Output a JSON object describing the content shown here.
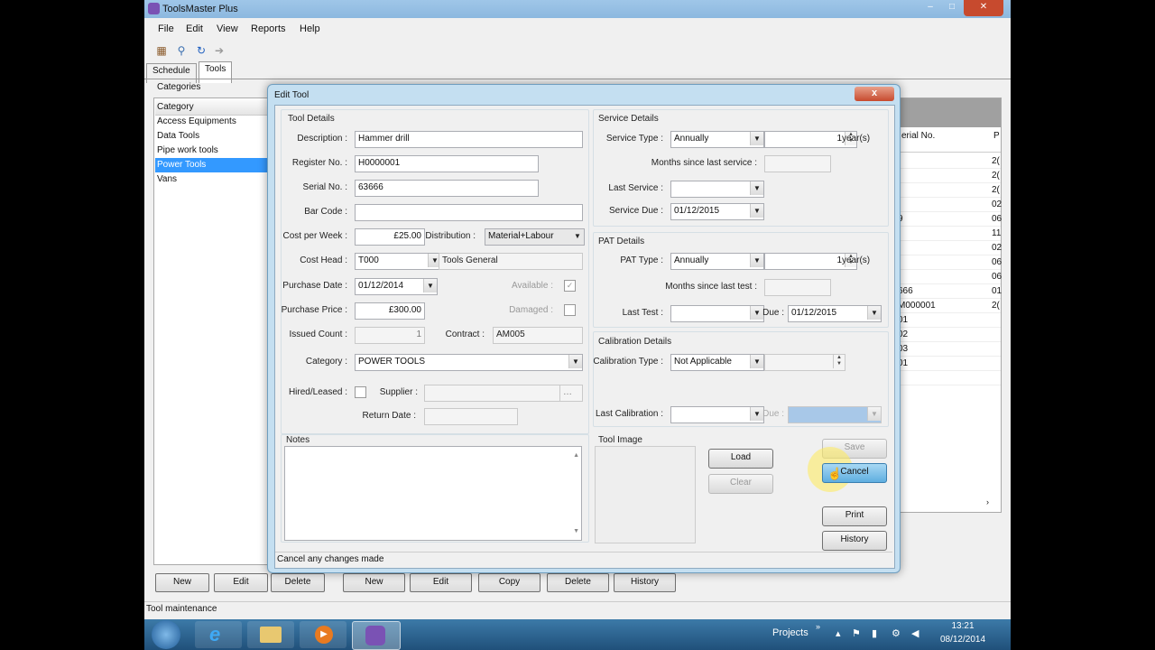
{
  "app": {
    "title": "ToolsMaster Plus"
  },
  "menu": [
    "File",
    "Edit",
    "View",
    "Reports",
    "Help"
  ],
  "tabs": [
    {
      "label": "Schedule"
    },
    {
      "label": "Tools"
    }
  ],
  "categories": {
    "heading": "Categories",
    "column": "Category",
    "items": [
      "Access Equipments",
      "Data Tools",
      "Pipe work tools",
      "Power Tools",
      "Vans"
    ],
    "selected": "Power Tools"
  },
  "tools_grid": {
    "col_serial": "erial No.",
    "col_p": "P",
    "serial_fragments": [
      "",
      "",
      "",
      "",
      "9",
      "",
      "",
      "",
      "",
      "666",
      "M000001",
      "01",
      "02",
      "03",
      "01",
      ""
    ],
    "p_fragments": [
      "2(",
      "2(",
      "2(",
      "02",
      "06",
      "11",
      "02",
      "06",
      "06",
      "01",
      "2(",
      "",
      "",
      "",
      "",
      ""
    ]
  },
  "left_buttons": [
    "New",
    "Edit",
    "Delete"
  ],
  "right_buttons": [
    "New",
    "Edit",
    "Copy",
    "Delete",
    "History"
  ],
  "status_bar": "Tool maintenance",
  "dialog": {
    "title": "Edit Tool",
    "close": "x",
    "tool_details": {
      "label": "Tool Details",
      "description_label": "Description :",
      "description": "Hammer drill",
      "register_label": "Register No. :",
      "register": "H0000001",
      "serial_label": "Serial No. :",
      "serial": "63666",
      "barcode_label": "Bar Code :",
      "barcode": "",
      "cost_label": "Cost per Week :",
      "cost": "£25.00",
      "distribution_label": "Distribution :",
      "distribution": "Material+Labour",
      "costhead_label": "Cost Head :",
      "costhead": "T000",
      "costhead_desc": "Tools General",
      "purchase_date_label": "Purchase Date :",
      "purchase_date": "01/12/2014",
      "available_label": "Available :",
      "purchase_price_label": "Purchase Price :",
      "purchase_price": "£300.00",
      "damaged_label": "Damaged :",
      "issued_label": "Issued Count :",
      "issued": "1",
      "contract_label": "Contract :",
      "contract": "AM005",
      "category_label": "Category :",
      "category": "POWER TOOLS",
      "hired_label": "Hired/Leased :",
      "supplier_label": "Supplier :",
      "return_label": "Return Date :"
    },
    "service": {
      "label": "Service Details",
      "type_label": "Service Type :",
      "type": "Annually",
      "interval": "1",
      "unit": "year(s)",
      "months_label": "Months since last service :",
      "last_label": "Last Service :",
      "due_label": "Service Due :",
      "due": "01/12/2015"
    },
    "pat": {
      "label": "PAT Details",
      "type_label": "PAT Type :",
      "type": "Annually",
      "interval": "1",
      "unit": "year(s)",
      "months_label": "Months since last test :",
      "last_label": "Last Test :",
      "due_label": "Due :",
      "due": "01/12/2015"
    },
    "calibration": {
      "label": "Calibration Details",
      "type_label": "Calibration Type :",
      "type": "Not Applicable",
      "last_label": "Last Calibration :",
      "due_label": "Due :"
    },
    "notes_label": "Notes",
    "image_label": "Tool Image",
    "buttons": {
      "load": "Load",
      "clear": "Clear",
      "save": "Save",
      "cancel": "Cancel",
      "print": "Print",
      "history": "History"
    },
    "status": "Cancel any changes made"
  },
  "taskbar": {
    "projects": "Projects",
    "time": "13:21",
    "date": "08/12/2014"
  }
}
